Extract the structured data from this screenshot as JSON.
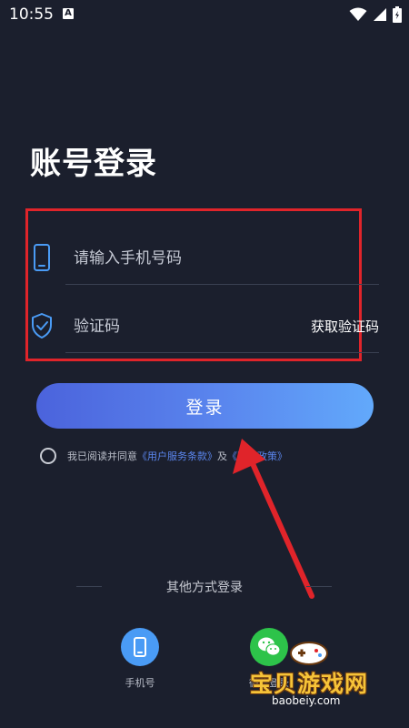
{
  "status_bar": {
    "time": "10:55",
    "notification_letter": "A"
  },
  "page": {
    "title": "账号登录"
  },
  "form": {
    "phone_placeholder": "请输入手机号码",
    "phone_value": "",
    "code_placeholder": "验证码",
    "code_value": "",
    "get_code_label": "获取验证码",
    "login_label": "登录"
  },
  "agreement": {
    "prefix": "我已阅读并同意",
    "terms_link": "《用户服务条款》",
    "and": "及",
    "privacy_link": "《隐私政策》"
  },
  "other_login": {
    "title": "其他方式登录",
    "options": [
      {
        "label": "手机号",
        "icon": "phone-icon"
      },
      {
        "label": "微信登录",
        "icon": "wechat-icon"
      }
    ]
  },
  "watermark": {
    "text": "宝贝游戏网",
    "url": "baobeiy.com"
  },
  "colors": {
    "background": "#1b1f2d",
    "highlight_box": "#e0242a",
    "button_gradient_start": "#4b63dc",
    "button_gradient_end": "#62a9fb",
    "link": "#5b86ee",
    "icon_blue": "#4a9bf5",
    "wechat_green": "#2dc34a"
  }
}
